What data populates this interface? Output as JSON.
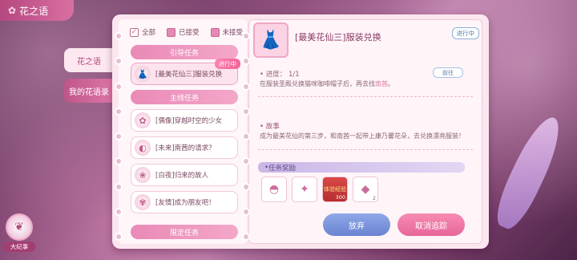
{
  "corner": {
    "title": "花之语"
  },
  "side_tabs": [
    {
      "label": "花之语"
    },
    {
      "label": "我的花语录"
    }
  ],
  "filters": [
    {
      "label": "全部",
      "checked": true
    },
    {
      "label": "已接受",
      "checked": false
    },
    {
      "label": "未接受",
      "checked": false
    }
  ],
  "categories": {
    "guide": "引导任务",
    "main": "主线任务",
    "limited": "限定任务"
  },
  "quest_list": [
    {
      "label": "[最美花仙三]服装兑换",
      "badge": "进行中"
    },
    {
      "label": "[偶像]穿越时空的少女"
    },
    {
      "label": "[未来]南茜的请求？"
    },
    {
      "label": "[白夜]归来的故人"
    },
    {
      "label": "[友情]成为朋友吧！"
    }
  ],
  "detail": {
    "title": "[最美花仙三]服装兑换",
    "status": "进行中",
    "progress_label": "进度：",
    "progress_value": "1/1",
    "progress_desc_pre": "在服装圣殿兑换猫咪咖啡帽子后，再去找",
    "progress_desc_name": "南茜",
    "progress_desc_post": "。",
    "goto_label": "前往",
    "story_label": "故事",
    "story_text": "成为最美花仙的第三步，和南茜一起带上康乃馨花朵，去兑换漂亮服装！",
    "reward_label": "任务奖励",
    "rewards": [
      {
        "icon": "dress-icon",
        "count": ""
      },
      {
        "icon": "bow-icon",
        "count": ""
      },
      {
        "icon": "exp-icon",
        "label": "体验经验",
        "count": "300"
      },
      {
        "icon": "gem-icon",
        "count": "2"
      }
    ],
    "abandon_label": "放弃",
    "cancel_label": "取消追踪"
  },
  "bottom": {
    "label": "大纪事"
  },
  "colors": {
    "accent": "#e8659a",
    "tag": "#f36296",
    "blue": "#6b82d0"
  }
}
